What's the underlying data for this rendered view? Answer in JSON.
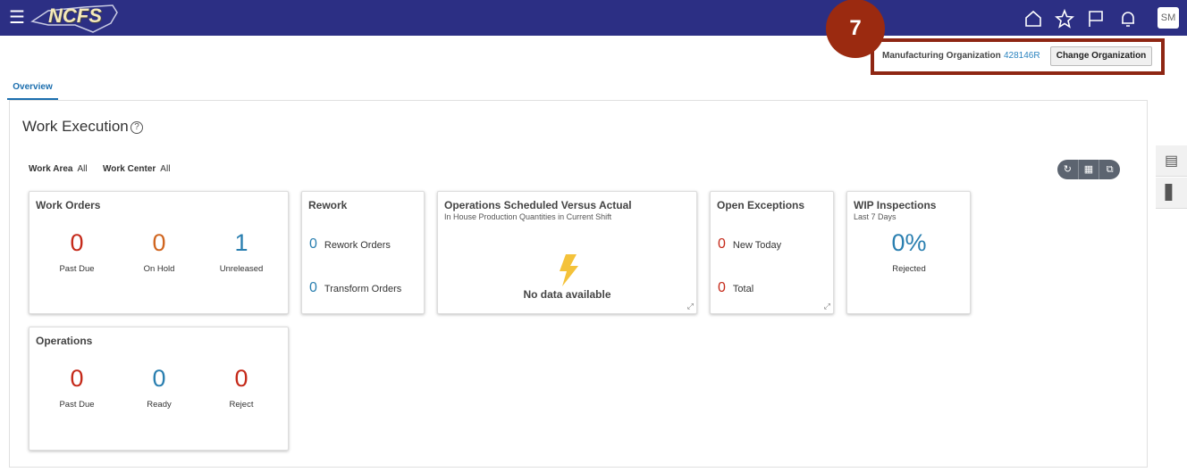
{
  "header": {
    "logo": "NCFS",
    "avatar": "SM",
    "icons": [
      "menu-icon",
      "home-icon",
      "star-icon",
      "flag-icon",
      "bell-icon"
    ]
  },
  "callout": {
    "number": "7",
    "color": "#9b2a10"
  },
  "org": {
    "label": "Manufacturing Organization",
    "value": "428146R",
    "button": "Change Organization"
  },
  "tabs": [
    {
      "label": "Overview",
      "active": true
    }
  ],
  "page": {
    "title": "Work Execution",
    "filters": [
      {
        "label": "Work Area",
        "value": "All"
      },
      {
        "label": "Work Center",
        "value": "All"
      }
    ]
  },
  "cards": {
    "work_orders": {
      "title": "Work Orders",
      "metrics": [
        {
          "value": "0",
          "label": "Past Due"
        },
        {
          "value": "0",
          "label": "On Hold"
        },
        {
          "value": "1",
          "label": "Unreleased"
        }
      ]
    },
    "rework": {
      "title": "Rework",
      "rows": [
        {
          "value": "0",
          "label": "Rework Orders"
        },
        {
          "value": "0",
          "label": "Transform Orders"
        }
      ]
    },
    "ops_sched": {
      "title": "Operations Scheduled Versus Actual",
      "subtitle": "In House Production Quantities in Current Shift",
      "empty": "No data available"
    },
    "exceptions": {
      "title": "Open Exceptions",
      "rows": [
        {
          "value": "0",
          "label": "New Today"
        },
        {
          "value": "0",
          "label": "Total"
        }
      ]
    },
    "wip": {
      "title": "WIP Inspections",
      "subtitle": "Last 7 Days",
      "value": "0%",
      "label": "Rejected"
    },
    "operations": {
      "title": "Operations",
      "metrics": [
        {
          "value": "0",
          "label": "Past Due"
        },
        {
          "value": "0",
          "label": "Ready"
        },
        {
          "value": "0",
          "label": "Reject"
        }
      ]
    }
  }
}
